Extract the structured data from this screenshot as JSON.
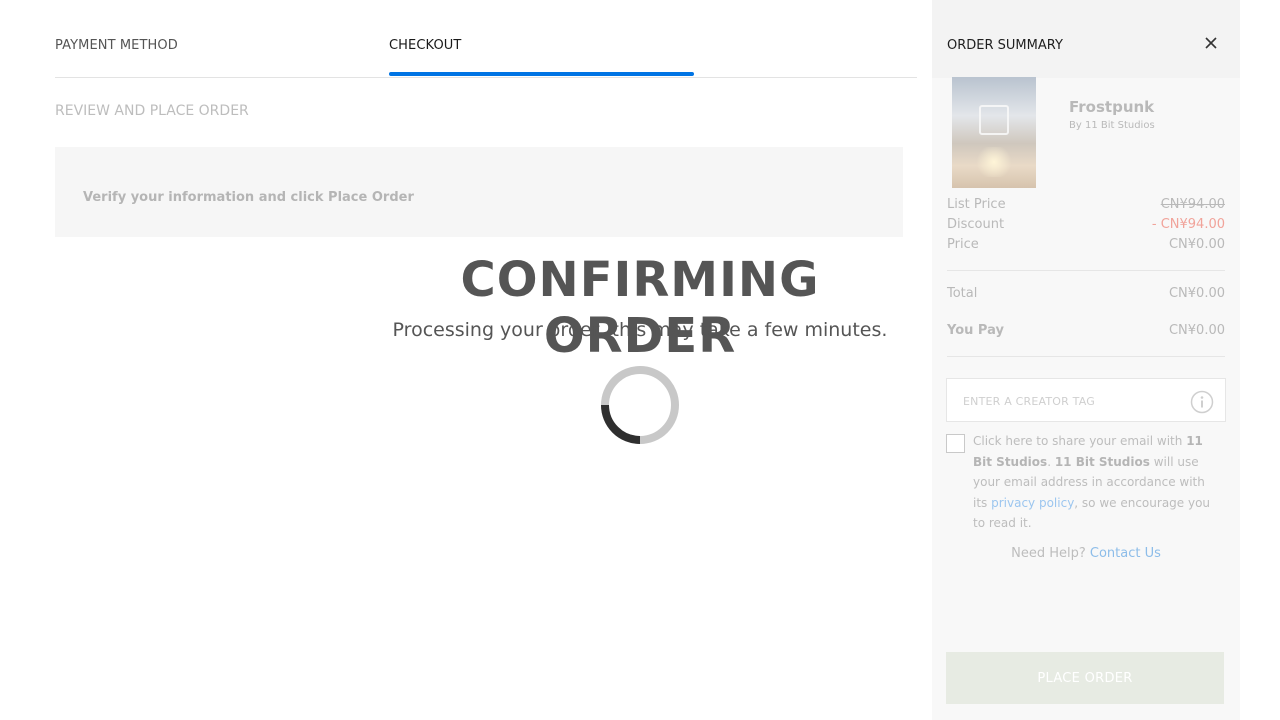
{
  "tabs": {
    "payment_method": "PAYMENT METHOD",
    "checkout": "CHECKOUT"
  },
  "review": {
    "heading": "REVIEW AND PLACE ORDER",
    "instruction": "Verify your information and click Place Order"
  },
  "overlay": {
    "title": "CONFIRMING ORDER",
    "subtitle": "Processing your order, this may take a few minutes.",
    "spinner_icon": "loading-spinner-icon"
  },
  "summary": {
    "title": "ORDER SUMMARY",
    "close_icon": "close-icon",
    "product": {
      "name": "Frostpunk",
      "by": "By 11 Bit Studios"
    },
    "list_price_label": "List Price",
    "list_price_value": "CN¥94.00",
    "discount_label": "Discount",
    "discount_value": "- CN¥94.00",
    "price_label": "Price",
    "price_value": "CN¥0.00",
    "total_label": "Total",
    "total_value": "CN¥0.00",
    "you_pay_label": "You Pay",
    "you_pay_value": "CN¥0.00",
    "creator_tag_placeholder": "ENTER A CREATOR TAG",
    "info_icon": "info-icon",
    "consent": {
      "prefix": "Click here to share your email with ",
      "publisher": "11 Bit Studios",
      "sep": ". ",
      "publisher2": "11 Bit Studios",
      "middle": " will use your email address in accordance with its ",
      "link": "privacy policy",
      "suffix": ", so we encourage you to read it."
    },
    "need_help": "Need Help?",
    "contact_us": "Contact Us",
    "place_order": "PLACE ORDER"
  },
  "colors": {
    "accent": "#0074e4",
    "discount": "#f1a39a",
    "link": "#8dbde9"
  }
}
